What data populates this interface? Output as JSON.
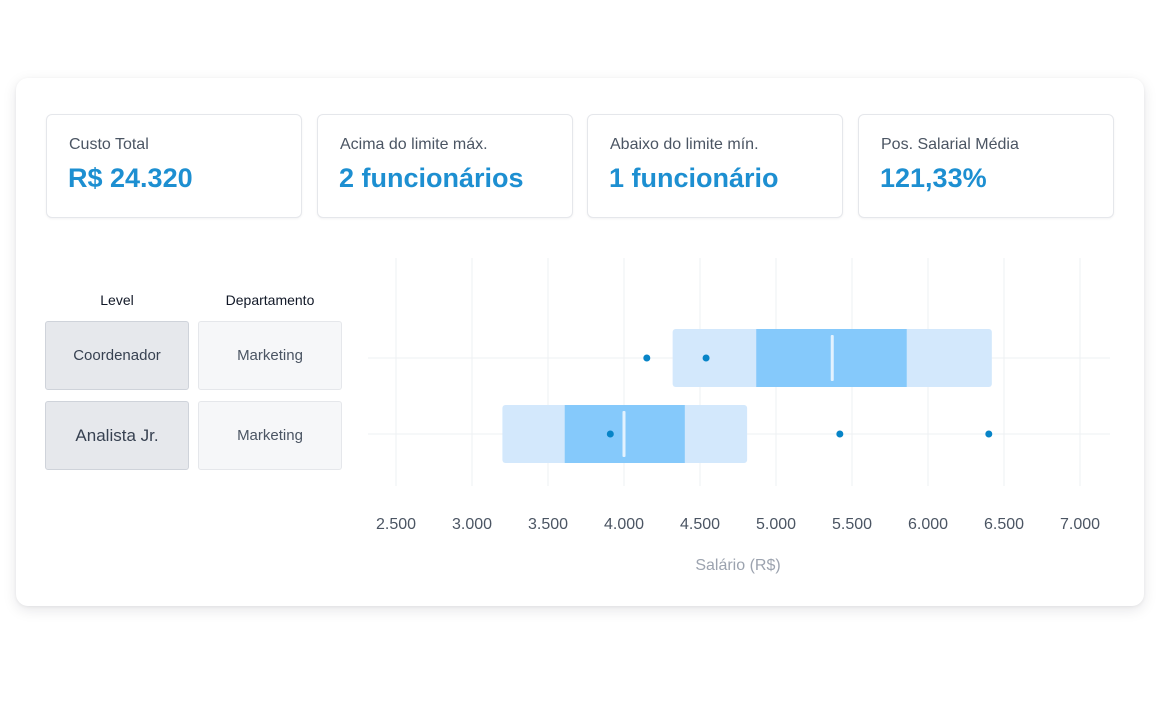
{
  "kpis": [
    {
      "label": "Custo Total",
      "value": "R$ 24.320"
    },
    {
      "label": "Acima do limite máx.",
      "value": "2 funcionários"
    },
    {
      "label": "Abaixo do limite mín.",
      "value": "1 funcionário"
    },
    {
      "label": "Pos. Salarial Média",
      "value": "121,33%"
    }
  ],
  "table": {
    "headers": {
      "level": "Level",
      "department": "Departamento"
    },
    "rows": [
      {
        "level": "Coordenador",
        "department": "Marketing"
      },
      {
        "level": "Analista Jr.",
        "department": "Marketing"
      }
    ]
  },
  "colors": {
    "range_outer": "#d3e8fc",
    "range_inner": "#85c9fb",
    "median": "#e3f2fe",
    "point": "#0784c7",
    "grid": "#eef0f3",
    "kpi_value": "#1d8fd1"
  },
  "chart_data": {
    "type": "boxplot",
    "orientation": "horizontal",
    "xlabel": "Salário (R$)",
    "xlim": [
      2500,
      7000
    ],
    "xticks": [
      2500,
      3000,
      3500,
      4000,
      4500,
      5000,
      5500,
      6000,
      6500,
      7000
    ],
    "xtick_labels": [
      "2.500",
      "3.000",
      "3.500",
      "4.000",
      "4.500",
      "5.000",
      "5.500",
      "6.000",
      "6.500",
      "7.000"
    ],
    "grid": true,
    "categories": [
      "Coordenador",
      "Analista Jr."
    ],
    "series": [
      {
        "range_min": 4320,
        "range_max": 6420,
        "band_min": 4870,
        "band_max": 5860,
        "median": 5370,
        "points": [
          4150,
          4540
        ]
      },
      {
        "range_min": 3200,
        "range_max": 4810,
        "band_min": 3610,
        "band_max": 4400,
        "median": 4000,
        "points": [
          3910,
          5420,
          6400
        ]
      }
    ]
  }
}
